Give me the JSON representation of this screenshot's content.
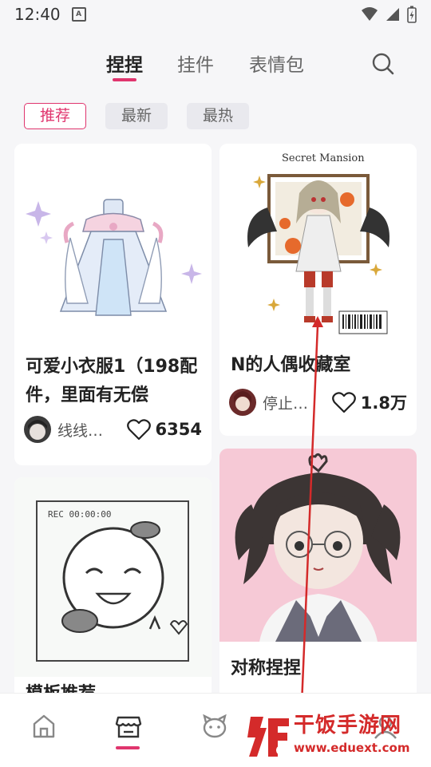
{
  "status": {
    "time": "12:40",
    "sim_label": "A"
  },
  "nav": {
    "tabs": [
      {
        "label": "捏捏"
      },
      {
        "label": "挂件"
      },
      {
        "label": "表情包"
      }
    ]
  },
  "filters": [
    {
      "label": "推荐"
    },
    {
      "label": "最新"
    },
    {
      "label": "最热"
    }
  ],
  "cards": [
    {
      "title": "可爱小衣服1（198配件，里面有无偿",
      "author": "线线…",
      "likes": "6354"
    },
    {
      "title": "N的人偶收藏室",
      "author": "停止…",
      "likes": "1.8万",
      "cover_text": "Secret Mansion"
    },
    {
      "title": "模板推荐",
      "cover_text": "REC 00:00:00"
    },
    {
      "title": "对称捏捏"
    }
  ],
  "watermark": {
    "title": "干饭手游网",
    "url": "www.eduext.com"
  },
  "colors": {
    "accent": "#e0356e",
    "watermark": "#d42a2a"
  }
}
